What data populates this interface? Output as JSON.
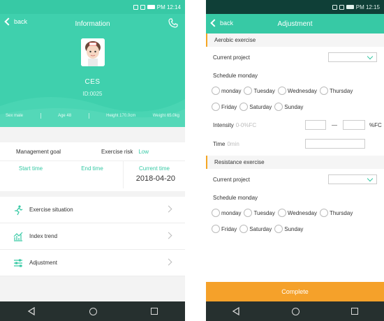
{
  "left": {
    "status": {
      "time": "PM 12:14"
    },
    "header": {
      "back_label": "back",
      "title": "Information"
    },
    "profile": {
      "name": "CES",
      "id": "ID:0025",
      "sex": "Sex  male",
      "age": "Age  48",
      "height": "Height 170.0cm",
      "weight": "Weight 65.0kg"
    },
    "goal": {
      "management_goal": "Management goal",
      "exercise_risk_label": "Exercise risk",
      "exercise_risk_value": "Low",
      "start_time": "Start time",
      "end_time": "End time",
      "current_time": "Current time",
      "current_date": "2018-04-20"
    },
    "menu": [
      {
        "label": "Exercise situation",
        "icon": "runner-icon"
      },
      {
        "label": "Index trend",
        "icon": "chart-icon"
      },
      {
        "label": "Adjustment",
        "icon": "sliders-icon"
      }
    ]
  },
  "right": {
    "status": {
      "time": "PM 12:15"
    },
    "header": {
      "back_label": "back",
      "title": "Adjustment"
    },
    "aerobic": {
      "title": "Aerobic exercise",
      "current_project": "Current project",
      "schedule": "Schedule  monday",
      "days": [
        "monday",
        "Tuesday",
        "Wednesday",
        "Thursday",
        "Friday",
        "Saturday",
        "Sunday"
      ],
      "intensity_label": "Intensity",
      "intensity_placeholder": "0-0%FC",
      "intensity_dash": "—",
      "intensity_unit": "%FC",
      "time_label": "Time",
      "time_placeholder": "0min"
    },
    "resistance": {
      "title": "Resistance exercise",
      "current_project": "Current project",
      "schedule": "Schedule  monday",
      "days": [
        "monday",
        "Tuesday",
        "Wednesday",
        "Thursday",
        "Friday",
        "Saturday",
        "Sunday"
      ]
    },
    "complete_label": "Complete"
  },
  "colors": {
    "accent": "#37c9a5",
    "orange": "#f5a12a",
    "navbar": "#26302f",
    "low": "#37c9a5"
  }
}
